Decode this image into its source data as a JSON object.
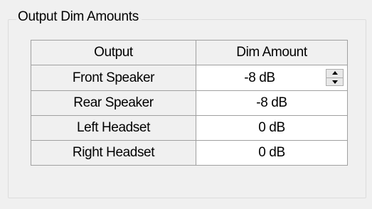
{
  "groupbox": {
    "title": "Output Dim Amounts"
  },
  "table": {
    "headers": {
      "output": "Output",
      "dim_amount": "Dim Amount"
    },
    "rows": [
      {
        "output": "Front Speaker",
        "dim_amount": "-8 dB"
      },
      {
        "output": "Rear Speaker",
        "dim_amount": "-8 dB"
      },
      {
        "output": "Left Headset",
        "dim_amount": "0 dB"
      },
      {
        "output": "Right Headset",
        "dim_amount": "0 dB"
      }
    ],
    "editing_row": 0
  },
  "spinner": {
    "up_icon": "triangle-up",
    "down_icon": "triangle-down"
  },
  "colors": {
    "background": "#f0f0f0",
    "grid_line": "#a0a0a0",
    "value_cell": "#ffffff",
    "group_border": "#dcdcdc"
  }
}
